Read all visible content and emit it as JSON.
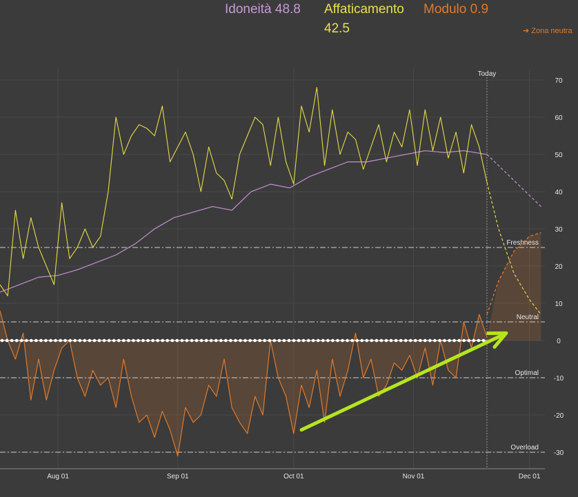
{
  "legend": {
    "fitness_label": "Idoneità 48.8",
    "fatigue_label": "Affaticamento",
    "fatigue_value": "42.5",
    "form_label": "Modulo 0.9",
    "zone_link": "➔ Zona neutra"
  },
  "colors": {
    "background": "#3b3b3b",
    "fitness": "#b98ac8",
    "fatigue": "#e6dc48",
    "form": "#e07a2c",
    "arrow": "#b5e61d"
  },
  "chart_data": {
    "type": "line",
    "x_ticks": [
      "Aug 01",
      "Sep 01",
      "Oct 01",
      "Nov 01",
      "Dec 01"
    ],
    "x_range": [
      "2024-07-17",
      "2024-12-05"
    ],
    "today": "2024-11-20",
    "today_label": "Today",
    "y_ticks": [
      70,
      60,
      50,
      40,
      30,
      20,
      10,
      0,
      -10,
      -20,
      -30
    ],
    "ylim": [
      -32,
      73
    ],
    "zones": [
      {
        "label": "Freshness",
        "value": 25
      },
      {
        "label": "Neutral",
        "value": 5
      },
      {
        "label": "Optimal",
        "value": -10
      },
      {
        "label": "Overload",
        "value": -30
      }
    ],
    "series": [
      {
        "name": "Idoneità",
        "x": [
          "2024-07-17",
          "2024-07-22",
          "2024-07-27",
          "2024-08-01",
          "2024-08-06",
          "2024-08-11",
          "2024-08-16",
          "2024-08-21",
          "2024-08-26",
          "2024-08-31",
          "2024-09-05",
          "2024-09-10",
          "2024-09-15",
          "2024-09-20",
          "2024-09-25",
          "2024-09-30",
          "2024-10-05",
          "2024-10-10",
          "2024-10-15",
          "2024-10-20",
          "2024-10-25",
          "2024-10-30",
          "2024-11-04",
          "2024-11-09",
          "2024-11-14",
          "2024-11-20"
        ],
        "y": [
          13,
          15,
          17,
          17.5,
          19,
          21,
          23,
          26,
          30,
          33,
          34.5,
          36,
          35,
          40,
          42,
          41,
          44,
          46,
          48,
          48,
          49,
          50,
          51,
          50.5,
          51,
          50
        ]
      },
      {
        "name": "Affaticamento",
        "x": [
          "2024-07-17",
          "2024-07-19",
          "2024-07-21",
          "2024-07-23",
          "2024-07-25",
          "2024-07-27",
          "2024-07-29",
          "2024-07-31",
          "2024-08-02",
          "2024-08-04",
          "2024-08-06",
          "2024-08-08",
          "2024-08-10",
          "2024-08-12",
          "2024-08-14",
          "2024-08-16",
          "2024-08-18",
          "2024-08-20",
          "2024-08-22",
          "2024-08-24",
          "2024-08-26",
          "2024-08-28",
          "2024-08-30",
          "2024-09-01",
          "2024-09-03",
          "2024-09-05",
          "2024-09-07",
          "2024-09-09",
          "2024-09-11",
          "2024-09-13",
          "2024-09-15",
          "2024-09-17",
          "2024-09-19",
          "2024-09-21",
          "2024-09-23",
          "2024-09-25",
          "2024-09-27",
          "2024-09-29",
          "2024-10-01",
          "2024-10-03",
          "2024-10-05",
          "2024-10-07",
          "2024-10-09",
          "2024-10-11",
          "2024-10-13",
          "2024-10-15",
          "2024-10-17",
          "2024-10-19",
          "2024-10-21",
          "2024-10-23",
          "2024-10-25",
          "2024-10-27",
          "2024-10-29",
          "2024-10-31",
          "2024-11-02",
          "2024-11-04",
          "2024-11-06",
          "2024-11-08",
          "2024-11-10",
          "2024-11-12",
          "2024-11-14",
          "2024-11-16",
          "2024-11-18",
          "2024-11-20"
        ],
        "y": [
          15,
          12,
          35,
          22,
          33,
          25,
          20,
          15,
          37,
          22,
          25,
          30,
          25,
          28,
          40,
          60,
          50,
          55,
          58,
          57,
          55,
          63,
          48,
          52,
          56,
          50,
          40,
          52,
          45,
          43,
          38,
          50,
          55,
          60,
          58,
          47,
          60,
          48,
          42,
          63,
          56,
          68,
          47,
          62,
          50,
          56,
          54,
          46,
          52,
          58,
          48,
          56,
          52,
          62,
          47,
          62,
          51,
          60,
          49,
          56,
          45,
          58,
          52,
          42.5
        ]
      },
      {
        "name": "Modulo",
        "x": [
          "2024-07-17",
          "2024-07-19",
          "2024-07-21",
          "2024-07-23",
          "2024-07-25",
          "2024-07-27",
          "2024-07-29",
          "2024-07-31",
          "2024-08-02",
          "2024-08-04",
          "2024-08-06",
          "2024-08-08",
          "2024-08-10",
          "2024-08-12",
          "2024-08-14",
          "2024-08-16",
          "2024-08-18",
          "2024-08-20",
          "2024-08-22",
          "2024-08-24",
          "2024-08-26",
          "2024-08-28",
          "2024-08-30",
          "2024-09-01",
          "2024-09-03",
          "2024-09-05",
          "2024-09-07",
          "2024-09-09",
          "2024-09-11",
          "2024-09-13",
          "2024-09-15",
          "2024-09-17",
          "2024-09-19",
          "2024-09-21",
          "2024-09-23",
          "2024-09-25",
          "2024-09-27",
          "2024-09-29",
          "2024-10-01",
          "2024-10-03",
          "2024-10-05",
          "2024-10-07",
          "2024-10-09",
          "2024-10-11",
          "2024-10-13",
          "2024-10-15",
          "2024-10-17",
          "2024-10-19",
          "2024-10-21",
          "2024-10-23",
          "2024-10-25",
          "2024-10-27",
          "2024-10-29",
          "2024-10-31",
          "2024-11-02",
          "2024-11-04",
          "2024-11-06",
          "2024-11-08",
          "2024-11-10",
          "2024-11-12",
          "2024-11-14",
          "2024-11-16",
          "2024-11-18",
          "2024-11-20"
        ],
        "y": [
          8,
          0,
          -5,
          2,
          -16,
          -5,
          -16,
          -8,
          -2,
          0,
          -10,
          -15,
          -8,
          -12,
          -10,
          -18,
          -5,
          -15,
          -22,
          -20,
          -26,
          -19,
          -24,
          -31,
          -18,
          -22,
          -20,
          -12,
          -15,
          -5,
          -18,
          -22,
          -25,
          -15,
          -20,
          0,
          -10,
          -15,
          -25,
          -12,
          -18,
          -8,
          -22,
          -5,
          -15,
          -8,
          2,
          -10,
          -5,
          -15,
          -12,
          -6,
          -8,
          -4,
          -10,
          -2,
          -12,
          0,
          -8,
          -10,
          5,
          -2,
          7,
          0.9
        ]
      },
      {
        "name": "Idoneità forecast",
        "x": [
          "2024-11-20",
          "2024-11-27",
          "2024-12-04"
        ],
        "y": [
          50,
          43,
          36
        ]
      },
      {
        "name": "Affaticamento forecast",
        "x": [
          "2024-11-20",
          "2024-11-23",
          "2024-11-27",
          "2024-12-01",
          "2024-12-04"
        ],
        "y": [
          42.5,
          30,
          18,
          11,
          7
        ]
      },
      {
        "name": "Modulo forecast",
        "x": [
          "2024-11-20",
          "2024-11-23",
          "2024-11-27",
          "2024-12-01",
          "2024-12-04"
        ],
        "y": [
          7,
          16,
          24,
          28,
          29
        ]
      }
    ],
    "annotation_arrow": {
      "from": {
        "x": "2024-10-03",
        "y": -24
      },
      "to": {
        "x": "2024-11-25",
        "y": 2
      }
    }
  }
}
